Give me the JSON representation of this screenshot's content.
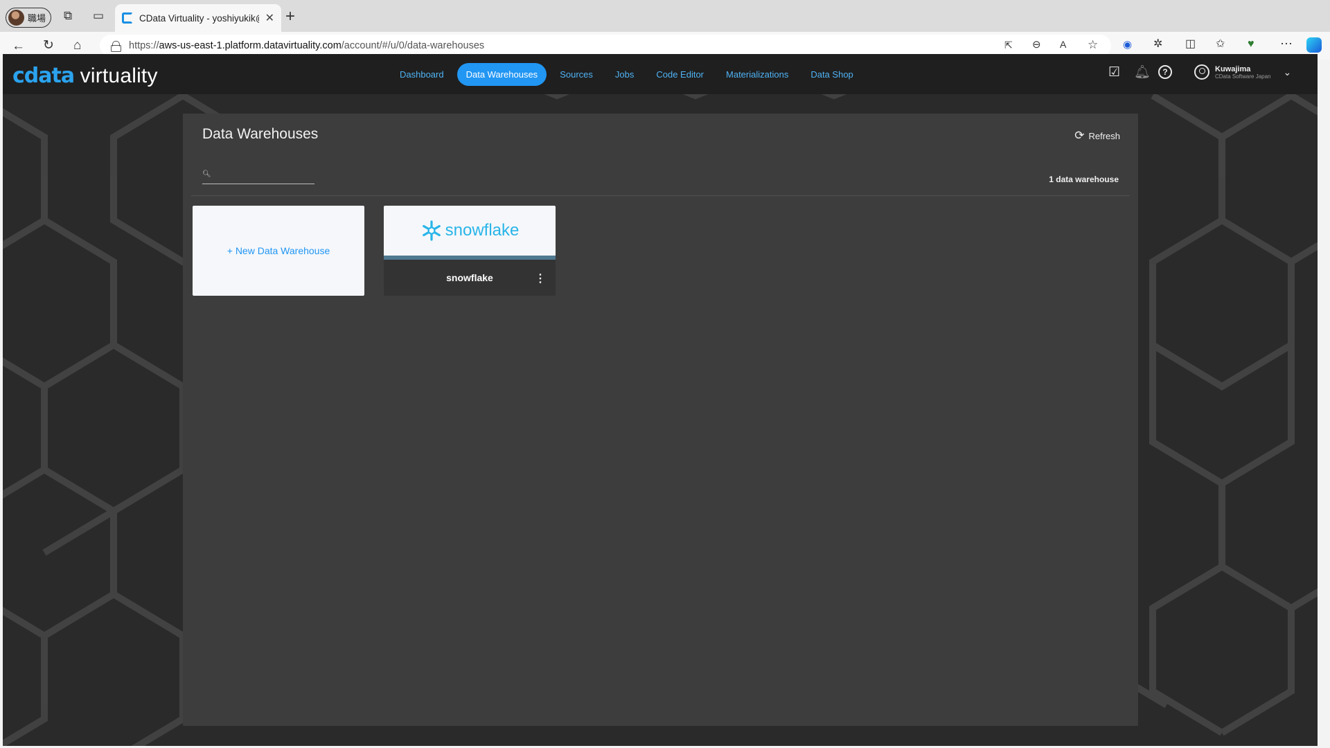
{
  "browser": {
    "profile_label": "職場",
    "tab_title": "CData Virtuality - yoshiyukik@",
    "url_scheme": "https://",
    "url_host": "aws-us-east-1.platform.datavirtuality.com",
    "url_path": "/account/#/u/0/data-warehouses"
  },
  "app": {
    "logo_brand": "cdata",
    "logo_product": "virtuality",
    "nav": [
      "Dashboard",
      "Data Warehouses",
      "Sources",
      "Jobs",
      "Code Editor",
      "Materializations",
      "Data Shop"
    ],
    "active_nav": "Data Warehouses",
    "user_name": "Kuwajima",
    "user_org": "CData Software Japan"
  },
  "page": {
    "title": "Data Warehouses",
    "refresh_label": "Refresh",
    "search_value": "",
    "count_label": "1 data warehouse",
    "new_card_label": "+ New Data Warehouse",
    "warehouses": [
      {
        "name": "snowflake",
        "logo_text": "snowflake"
      }
    ]
  },
  "colors": {
    "accent": "#2196f3",
    "snowflake": "#29b5e8"
  }
}
